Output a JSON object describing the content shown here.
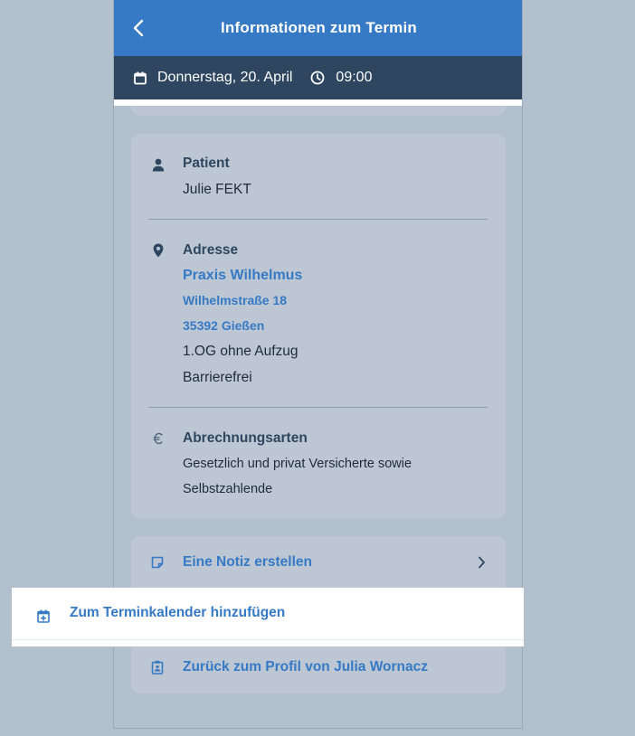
{
  "header": {
    "title": "Informationen zum Termin",
    "back_icon": "chevron-left-icon"
  },
  "appointment": {
    "date": "Donnerstag, 20. April",
    "time": "09:00",
    "date_icon": "calendar-icon",
    "time_icon": "clock-icon"
  },
  "patient": {
    "title": "Patient",
    "name": "Julie FEKT",
    "icon": "person-icon"
  },
  "address": {
    "title": "Adresse",
    "practice": "Praxis Wilhelmus",
    "street": "Wilhelmstraße 18",
    "city": "35392 Gießen",
    "floor": "1.OG ohne Aufzug",
    "accessibility": "Barrierefrei",
    "icon": "location-pin-icon"
  },
  "billing": {
    "title": "Abrechnungsarten",
    "line1": "Gesetzlich und privat Versicherte sowie",
    "line2": "Selbstzahlende",
    "icon": "euro-icon"
  },
  "actions": {
    "note": "Eine Notiz erstellen",
    "calendar": "Zum Terminkalender hinzufügen",
    "profile": "Zurück zum Profil von Julia Wornacz"
  },
  "colors": {
    "accent": "#3679c5",
    "dark_bar": "#2e4660",
    "background": "#b2bfcc",
    "card": "#bcc7d3"
  }
}
